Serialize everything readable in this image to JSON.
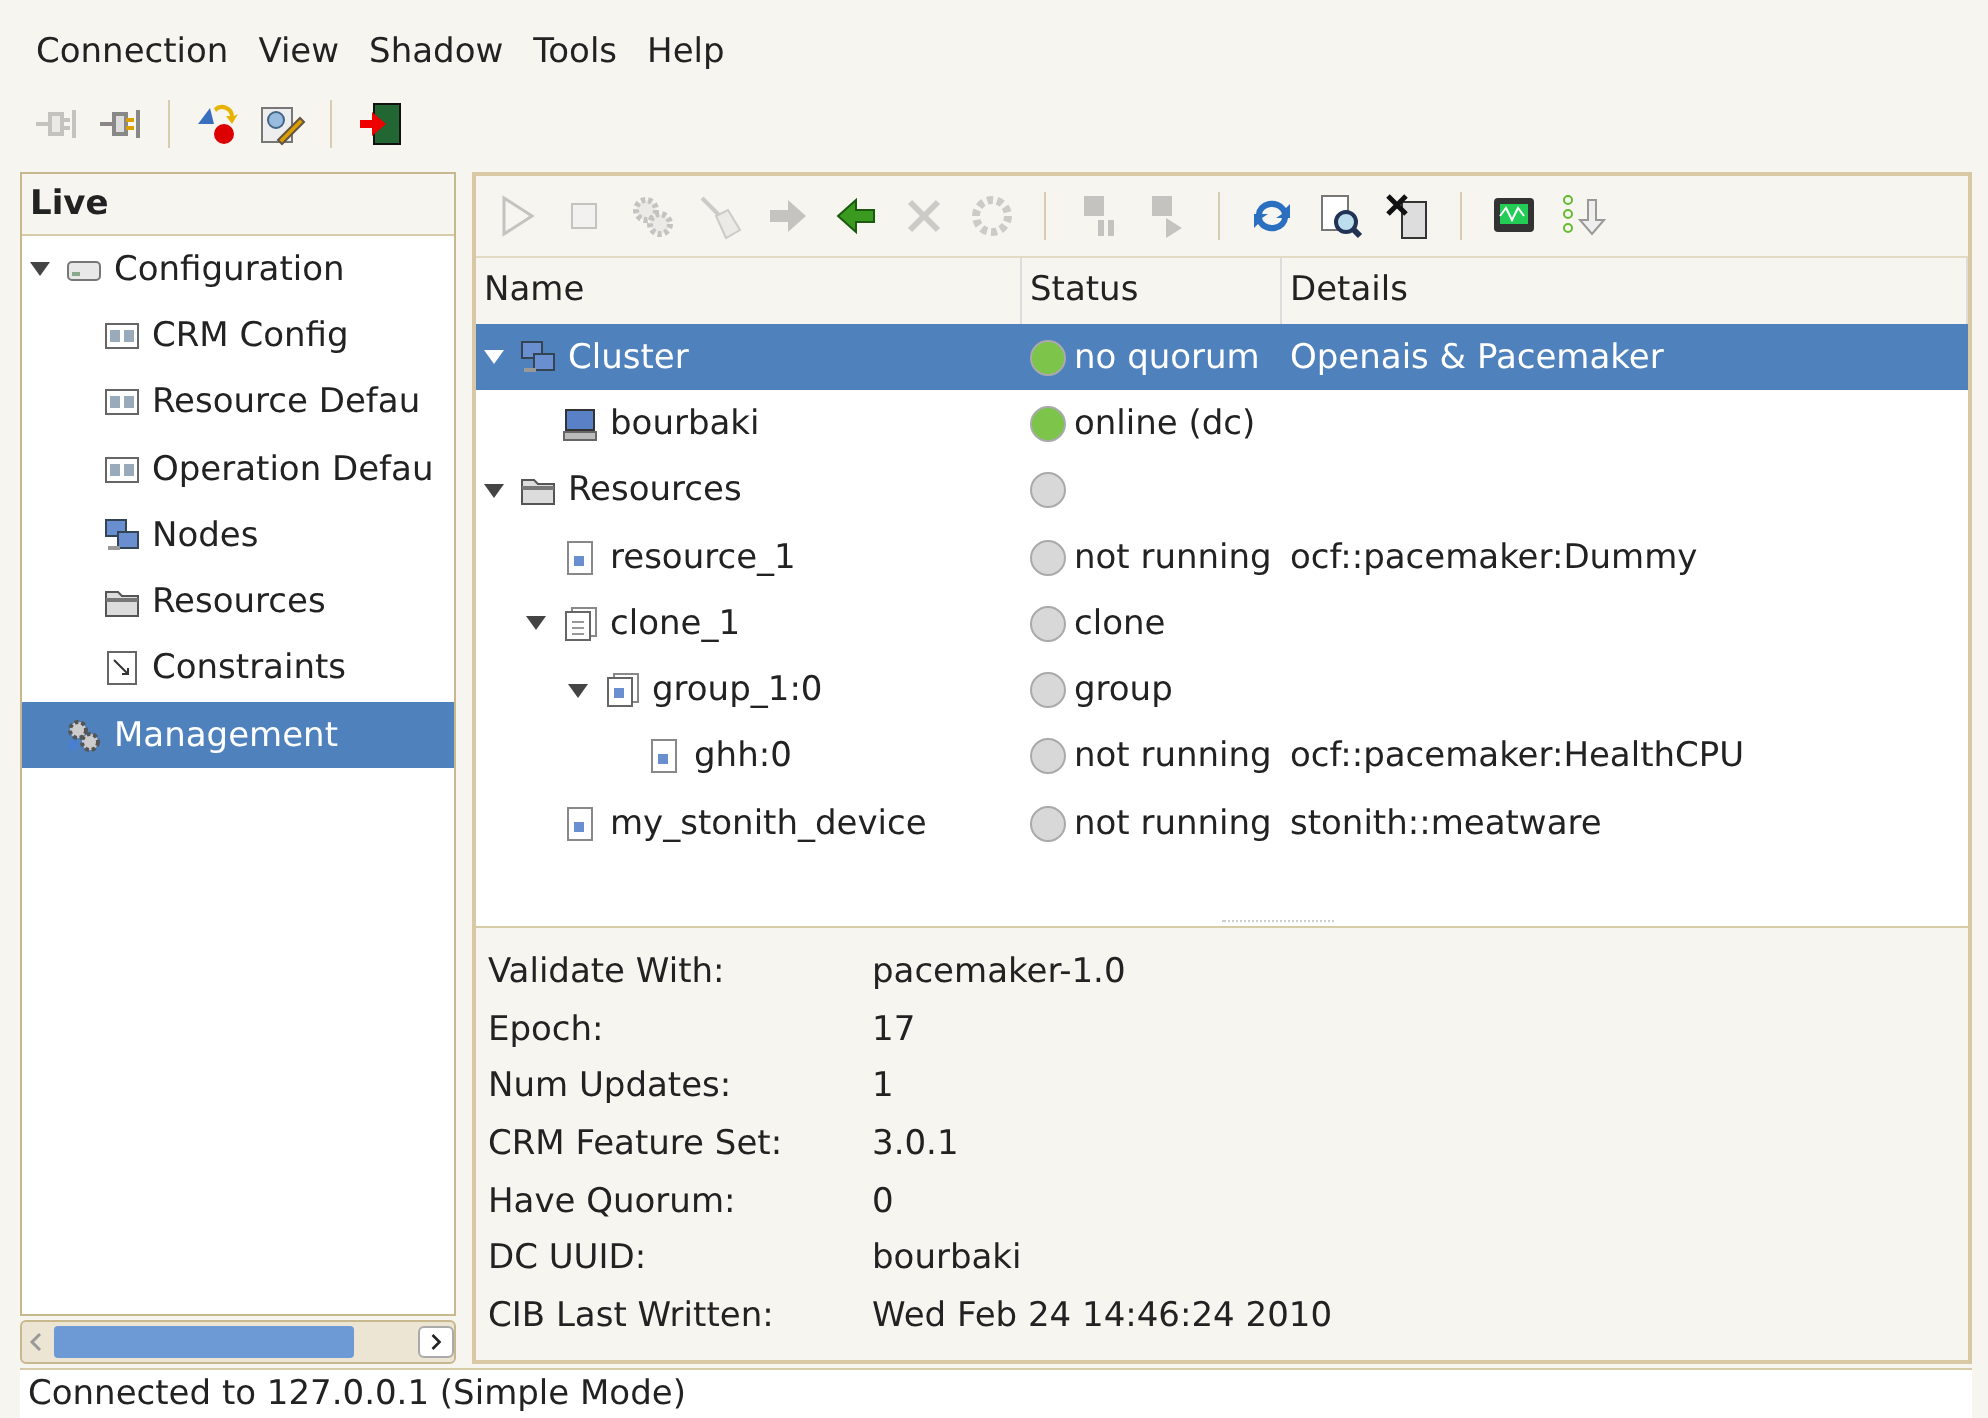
{
  "menu": [
    "Connection",
    "View",
    "Shadow",
    "Tools",
    "Help"
  ],
  "main_toolbar": [
    {
      "kind": "unplug",
      "disabled": true
    },
    {
      "kind": "plug",
      "disabled": false
    },
    {
      "kind": "sep"
    },
    {
      "kind": "shapes",
      "disabled": false
    },
    {
      "kind": "edit",
      "disabled": false
    },
    {
      "kind": "sep"
    },
    {
      "kind": "exit",
      "disabled": false
    }
  ],
  "sidebar": {
    "title": "Live",
    "items": [
      {
        "label": "Configuration",
        "kind": "disk",
        "expanded": true,
        "selected": false,
        "children": [
          {
            "label": "CRM Config",
            "kind": "config",
            "selected": false
          },
          {
            "label": "Resource Defau",
            "kind": "config",
            "selected": false
          },
          {
            "label": "Operation Defau",
            "kind": "config",
            "selected": false
          },
          {
            "label": "Nodes",
            "kind": "nodes",
            "selected": false
          },
          {
            "label": "Resources",
            "kind": "folder",
            "selected": false
          },
          {
            "label": "Constraints",
            "kind": "doc",
            "selected": false
          }
        ]
      },
      {
        "label": "Management",
        "kind": "gears",
        "selected": true
      }
    ]
  },
  "toolbar": [
    {
      "kind": "play",
      "disabled": true
    },
    {
      "kind": "stop",
      "disabled": true
    },
    {
      "kind": "gears",
      "disabled": true
    },
    {
      "kind": "broom",
      "disabled": true
    },
    {
      "kind": "right",
      "disabled": true
    },
    {
      "kind": "left",
      "disabled": false
    },
    {
      "kind": "cross",
      "disabled": true
    },
    {
      "kind": "cog",
      "disabled": true
    },
    {
      "kind": "sep"
    },
    {
      "kind": "pause",
      "disabled": true
    },
    {
      "kind": "down",
      "disabled": true
    },
    {
      "kind": "sep"
    },
    {
      "kind": "refresh",
      "disabled": false
    },
    {
      "kind": "find",
      "disabled": false
    },
    {
      "kind": "tools",
      "disabled": false
    },
    {
      "kind": "sep"
    },
    {
      "kind": "monitor",
      "disabled": false
    },
    {
      "kind": "steps",
      "disabled": false
    }
  ],
  "table": {
    "columns": [
      "Name",
      "Status",
      "Details"
    ],
    "rows": [
      {
        "name": "Cluster",
        "kind": "cluster",
        "expanded": true,
        "selected": true,
        "color": "#7cc44a",
        "status": "no quorum",
        "details": "Openais & Pacemaker",
        "children": [
          {
            "name": "bourbaki",
            "kind": "host",
            "selected": false,
            "color": "#7cc44a",
            "status": "online (dc)"
          }
        ]
      },
      {
        "name": "Resources",
        "kind": "folder",
        "expanded": true,
        "selected": false,
        "color": "#d8d8d8",
        "children": [
          {
            "name": "resource_1",
            "kind": "resource",
            "selected": false,
            "color": "#d8d8d8",
            "status": "not running",
            "details": "ocf::pacemaker:Dummy"
          },
          {
            "name": "clone_1",
            "kind": "clone",
            "expanded": true,
            "selected": false,
            "color": "#d8d8d8",
            "status": "clone",
            "children": [
              {
                "name": "group_1:0",
                "kind": "group",
                "expanded": true,
                "selected": false,
                "color": "#d8d8d8",
                "status": "group",
                "children": [
                  {
                    "name": "ghh:0",
                    "kind": "resource",
                    "selected": false,
                    "color": "#d8d8d8",
                    "status": "not running",
                    "details": "ocf::pacemaker:HealthCPU"
                  }
                ]
              }
            ]
          },
          {
            "name": "my_stonith_device",
            "kind": "resource",
            "selected": false,
            "color": "#d8d8d8",
            "status": "not running",
            "details": "stonith::meatware"
          }
        ]
      }
    ]
  },
  "details": [
    {
      "label": "Validate With:",
      "value": "pacemaker-1.0"
    },
    {
      "label": "Epoch:",
      "value": "17"
    },
    {
      "label": "Num Updates:",
      "value": "1"
    },
    {
      "label": "CRM Feature Set:",
      "value": "3.0.1"
    },
    {
      "label": "Have Quorum:",
      "value": "0"
    },
    {
      "label": "DC UUID:",
      "value": "bourbaki"
    },
    {
      "label": "CIB Last Written:",
      "value": "Wed Feb 24 14:46:24 2010"
    }
  ],
  "status_bar": "Connected to 127.0.0.1 (Simple Mode)"
}
